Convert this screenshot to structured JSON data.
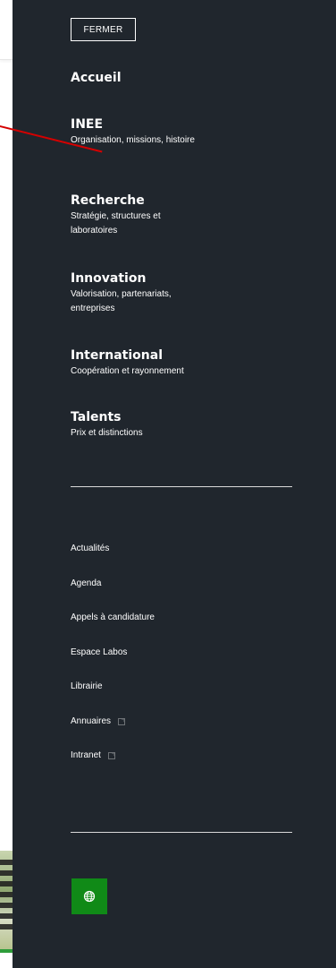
{
  "menu": {
    "close_label": "FERMER",
    "main_items": [
      {
        "title": "Accueil",
        "subtitle": ""
      },
      {
        "title": "INEE",
        "subtitle": "Organisation, missions, histoire"
      },
      {
        "title": "Recherche",
        "subtitle": "Stratégie, structures et laboratoires"
      },
      {
        "title": "Innovation",
        "subtitle": "Valorisation, partenariats, entreprises"
      },
      {
        "title": "International",
        "subtitle": "Coopération et rayonnement"
      },
      {
        "title": "Talents",
        "subtitle": "Prix et distinctions"
      }
    ],
    "secondary_items": [
      {
        "label": "Actualités",
        "external": false
      },
      {
        "label": "Agenda",
        "external": false
      },
      {
        "label": "Appels à candidature",
        "external": false
      },
      {
        "label": "Espace Labos",
        "external": false
      },
      {
        "label": "Librairie",
        "external": false
      },
      {
        "label": "Annuaires",
        "external": true
      },
      {
        "label": "Intranet",
        "external": true
      }
    ],
    "language_icon": "globe-icon"
  },
  "colors": {
    "panel_bg": "#20262d",
    "text": "#ffffff",
    "accent_green": "#108a17",
    "annotation_red": "#d40000"
  }
}
